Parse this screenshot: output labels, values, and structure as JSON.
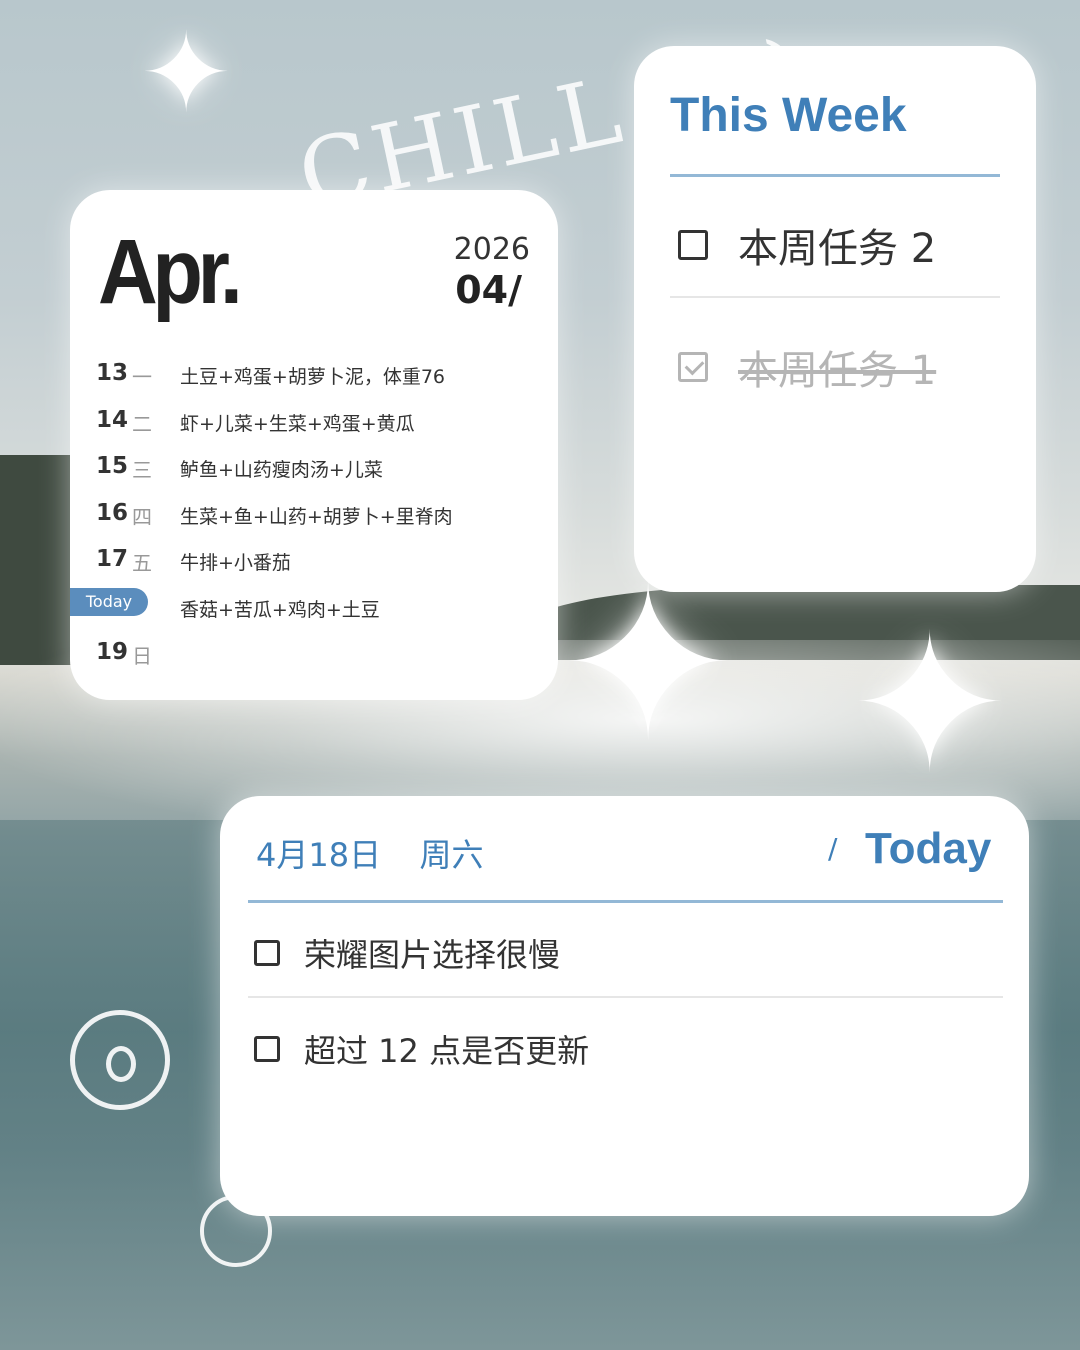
{
  "background": {
    "decoration_text": "CHILL :)))",
    "sparkle_icon": "four-point-star-icon",
    "flower_icon": "flower-outline-icon"
  },
  "calendar": {
    "month": "Apr.",
    "year": "2026",
    "month_number": "04/",
    "today_label": "Today",
    "rows": [
      {
        "date": "13",
        "weekday": "一",
        "meal": "土豆+鸡蛋+胡萝卜泥，体重76"
      },
      {
        "date": "14",
        "weekday": "二",
        "meal": "虾+儿菜+生菜+鸡蛋+黄瓜"
      },
      {
        "date": "15",
        "weekday": "三",
        "meal": "鲈鱼+山药瘦肉汤+儿菜"
      },
      {
        "date": "16",
        "weekday": "四",
        "meal": "生菜+鱼+山药+胡萝卜+里脊肉"
      },
      {
        "date": "17",
        "weekday": "五",
        "meal": "牛排+小番茄"
      },
      {
        "date": "",
        "weekday": "",
        "meal": "香菇+苦瓜+鸡肉+土豆",
        "is_today": true
      },
      {
        "date": "19",
        "weekday": "日",
        "meal": ""
      }
    ]
  },
  "this_week": {
    "title": "This Week",
    "tasks": [
      {
        "text": "本周任务 2",
        "done": false
      },
      {
        "text": "本周任务 1",
        "done": true
      }
    ]
  },
  "today": {
    "date": "4月18日",
    "weekday": "周六",
    "separator": "/",
    "title": "Today",
    "tasks": [
      {
        "text": "荣耀图片选择很慢",
        "done": false
      },
      {
        "text": "超过 12 点是否更新",
        "done": false
      }
    ]
  },
  "colors": {
    "accent": "#3f7fb8",
    "today_pill": "#5b8dbd",
    "divider": "#93b8d6"
  }
}
